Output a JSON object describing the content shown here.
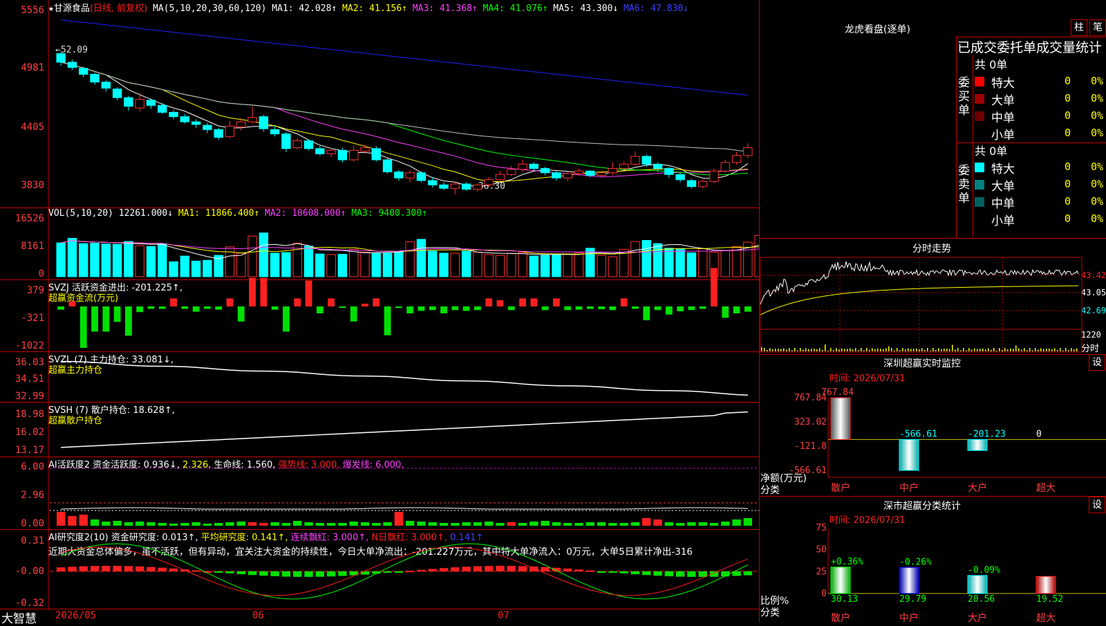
{
  "stock": {
    "star": "★",
    "name": "甘源食品",
    "mode": "(日线, 前复权)"
  },
  "kline": {
    "ma_label": "MA(5,10,20,30,60,120)",
    "ma1": "MA1: 42.028↑",
    "ma2": "MA2: 41.156↑",
    "ma3": "MA3: 41.368↑",
    "ma4": "MA4: 41.076↑",
    "ma5": "MA5: 43.300↓",
    "ma6": "MA6: 47.830↓",
    "yticks": [
      "5556",
      "4981",
      "4405",
      "3830"
    ],
    "high_label": "←52.09",
    "low_label": "←38.30",
    "candles": [
      [
        51.9,
        50.9,
        52.1,
        50.5
      ],
      [
        50.9,
        50.3,
        51.2,
        50.0
      ],
      [
        50.2,
        49.5,
        50.4,
        49.2
      ],
      [
        49.5,
        48.6,
        49.7,
        48.3
      ],
      [
        48.6,
        47.9,
        48.8,
        47.5
      ],
      [
        47.8,
        46.8,
        48.0,
        46.5
      ],
      [
        46.8,
        45.8,
        47.0,
        45.3
      ],
      [
        45.6,
        46.6,
        47.4,
        45.2
      ],
      [
        46.5,
        45.9,
        46.7,
        45.5
      ],
      [
        45.9,
        45.1,
        46.2,
        44.9
      ],
      [
        45.1,
        44.6,
        45.4,
        44.3
      ],
      [
        44.6,
        44.0,
        44.9,
        43.8
      ],
      [
        44.0,
        43.7,
        44.3,
        43.3
      ],
      [
        43.6,
        43.1,
        43.9,
        42.7
      ],
      [
        43.1,
        42.2,
        43.3,
        41.9
      ],
      [
        42.3,
        43.5,
        44.1,
        42.1
      ],
      [
        43.4,
        44.0,
        44.4,
        43.0
      ],
      [
        44.0,
        44.5,
        45.8,
        43.8
      ],
      [
        44.6,
        43.2,
        44.8,
        42.9
      ],
      [
        43.1,
        42.6,
        43.5,
        42.3
      ],
      [
        42.6,
        40.9,
        42.8,
        40.5
      ],
      [
        41.0,
        41.8,
        42.1,
        40.8
      ],
      [
        41.8,
        40.9,
        42.0,
        40.7
      ],
      [
        40.9,
        40.3,
        41.2,
        40.1
      ],
      [
        40.3,
        40.7,
        41.0,
        39.9
      ],
      [
        40.7,
        39.6,
        41.0,
        39.3
      ],
      [
        39.6,
        40.7,
        41.3,
        39.4
      ],
      [
        40.6,
        41.0,
        41.4,
        40.3
      ],
      [
        40.9,
        39.6,
        41.2,
        39.4
      ],
      [
        39.6,
        38.2,
        39.9,
        38.0
      ],
      [
        38.2,
        37.5,
        38.4,
        37.2
      ],
      [
        37.5,
        38.1,
        38.4,
        37.0
      ],
      [
        38.1,
        37.2,
        38.3,
        37.0
      ],
      [
        37.2,
        36.7,
        37.6,
        36.4
      ],
      [
        36.7,
        36.3,
        37.0,
        36.1
      ],
      [
        36.3,
        36.8,
        37.1,
        35.6
      ],
      [
        36.8,
        36.2,
        37.0,
        36.0
      ],
      [
        36.2,
        36.7,
        36.9,
        35.9
      ],
      [
        36.7,
        37.3,
        37.6,
        36.5
      ],
      [
        37.3,
        37.9,
        38.3,
        37.1
      ],
      [
        37.9,
        38.5,
        38.9,
        37.7
      ],
      [
        38.5,
        39.1,
        39.6,
        38.2
      ],
      [
        39.1,
        38.6,
        39.3,
        38.3
      ],
      [
        38.6,
        38.1,
        38.8,
        37.8
      ],
      [
        38.1,
        37.5,
        38.3,
        37.2
      ],
      [
        37.5,
        38.0,
        38.2,
        37.1
      ],
      [
        38.0,
        38.3,
        38.6,
        37.7
      ],
      [
        38.3,
        37.8,
        38.4,
        37.6
      ],
      [
        37.8,
        38.1,
        38.3,
        37.5
      ],
      [
        38.1,
        38.6,
        39.3,
        37.8
      ],
      [
        38.6,
        39.1,
        39.4,
        38.4
      ],
      [
        39.1,
        40.0,
        40.6,
        38.9
      ],
      [
        40.0,
        39.1,
        40.2,
        38.8
      ],
      [
        39.1,
        38.6,
        39.3,
        38.2
      ],
      [
        38.6,
        37.9,
        38.8,
        37.5
      ],
      [
        37.9,
        37.3,
        38.1,
        37.0
      ],
      [
        37.2,
        36.5,
        37.4,
        36.3
      ],
      [
        36.5,
        37.1,
        37.3,
        36.3
      ],
      [
        37.1,
        38.3,
        38.6,
        36.9
      ],
      [
        38.3,
        39.3,
        39.6,
        38.1
      ],
      [
        39.3,
        40.1,
        40.5,
        39.0
      ],
      [
        40.1,
        41.0,
        41.5,
        39.8
      ]
    ]
  },
  "vol": {
    "label": "VOL(5,10,20)",
    "val": "12261.000↓",
    "ma1": "MA1: 11866.400↑",
    "ma2": "MA2: 10608.000↑",
    "ma3": "MA3: 9400.300↑",
    "yticks": [
      "16526",
      "8161",
      "0"
    ],
    "values": [
      9500,
      10800,
      9300,
      9400,
      9200,
      9100,
      9900,
      8700,
      8500,
      9300,
      4200,
      5800,
      4400,
      4600,
      6000,
      8400,
      6600,
      11400,
      12300,
      6600,
      6800,
      9400,
      8600,
      6400,
      6200,
      6300,
      7700,
      6900,
      6700,
      6600,
      6900,
      9800,
      10500,
      7200,
      6600,
      6600,
      7200,
      6900,
      6200,
      6000,
      6500,
      6800,
      5800,
      6000,
      6200,
      6400,
      6700,
      8000,
      6000,
      5600,
      7700,
      9900,
      10200,
      9300,
      8000,
      7800,
      6700,
      7900,
      6900,
      7400,
      8500,
      9700,
      11600,
      12261
    ]
  },
  "svzj": {
    "label": "SVZJ  活跃资金进出: -201.225↑,",
    "sub": "超赢资金流(万元)",
    "yticks": [
      "379",
      "-321",
      "-1022"
    ],
    "values": [
      -80,
      60,
      -1022,
      -620,
      -620,
      -380,
      -720,
      -140,
      -60,
      -60,
      90,
      -60,
      -130,
      -60,
      -80,
      90,
      -370,
      320,
      320,
      -80,
      -620,
      90,
      290,
      -170,
      90,
      -20,
      -370,
      30,
      90,
      -710,
      -20,
      -170,
      -110,
      -90,
      -170,
      -90,
      -110,
      -90,
      90,
      70,
      -90,
      90,
      90,
      -90,
      90,
      -90,
      -80,
      -60,
      -70,
      -90,
      90,
      -60,
      -340,
      -90,
      -200,
      -120,
      -90,
      -60,
      430,
      -280,
      -170,
      -130
    ]
  },
  "svzl": {
    "label": "SVZL (7) 主力持仓: 33.081↓,",
    "sub": "超赢主力持仓",
    "yticks": [
      "36.03",
      "34.51",
      "32.99"
    ]
  },
  "svsh": {
    "label": "SVSH (7) 散户持仓: 18.628↑,",
    "sub": "超赢散户持仓",
    "yticks": [
      "18.98",
      "16.02",
      "13.17"
    ]
  },
  "ai1": {
    "label": "AI活跃度2 资金活跃度: 0.936↓,",
    "v2": "2.326,",
    "v3": "生命线: 1.560,",
    "v4": "强势线: 3.000,",
    "v5": "爆发线: 6.000,",
    "yticks": [
      "6.00",
      "2.96",
      "0.00"
    ]
  },
  "ai2": {
    "label": "AI研究度2(10) 资金研究度: 0.013↑,",
    "v2": "平均研究度: 0.141↑,",
    "v3": "连续飘红: 3.000↑,",
    "v4": "N日飘红: 3.000↑,",
    "v5": "0.141↑",
    "text": "近期大资金总体偏多，虽不活跃，但有异动，宜关注大资金的持续性，今日大单净流出：-201.227万元，其中特大单净流入：0万元，大单5日累计净出-316",
    "yticks": [
      "0.31",
      "-0.00",
      "-0.32"
    ]
  },
  "dates": {
    "d1": "2026/05",
    "d2": "06",
    "d3": "07"
  },
  "brand": "大智慧",
  "right": {
    "lhb_title": "龙虎看盘(逐单)",
    "btn_zhu": "柱",
    "btn_bi": "笔",
    "stats_header": "已成交委托单成交量统计",
    "buy_label": "委买单",
    "sell_label": "委卖单",
    "buy_total": "共 0单",
    "sell_total": "共 0单",
    "buy_rows": [
      {
        "name": "特大",
        "v": "0",
        "p": "0%",
        "color": "#ff0000"
      },
      {
        "name": "大单",
        "v": "0",
        "p": "0%",
        "color": "#a00000"
      },
      {
        "name": "中单",
        "v": "0",
        "p": "0%",
        "color": "#700000"
      },
      {
        "name": "小单",
        "v": "0",
        "p": "0%",
        "color": "#000000"
      }
    ],
    "sell_rows": [
      {
        "name": "特大",
        "v": "0",
        "p": "0%",
        "color": "#00ffff"
      },
      {
        "name": "大单",
        "v": "0",
        "p": "0%",
        "color": "#008080"
      },
      {
        "name": "中单",
        "v": "0",
        "p": "0%",
        "color": "#006060"
      },
      {
        "name": "小单",
        "v": "0",
        "p": "0%",
        "color": "#000000"
      }
    ],
    "fs_title": "分时走势",
    "fs_y": [
      "43.42",
      "43.05",
      "42.69"
    ],
    "fs_vol": "1220",
    "fs_vol_label": "分时",
    "sz_title": "深圳超赢实时监控",
    "sz_btn": "设",
    "sz_time": "时间: 2026/07/31",
    "sz_y": [
      "767.84",
      "323.02",
      "-121.8",
      "-566.61"
    ],
    "sz_ylabel": "净额(万元)",
    "sz_xlabel": "分类",
    "sz_bars": [
      {
        "name": "散户",
        "value": "767.84"
      },
      {
        "name": "中户",
        "value": "-566.61"
      },
      {
        "name": "大户",
        "value": "-201.23"
      },
      {
        "name": "超大",
        "value": "0"
      }
    ],
    "cls_title": "深市超赢分类统计",
    "cls_btn": "设",
    "cls_time": "时间: 2026/07/31",
    "cls_y": [
      "75",
      "50",
      "25",
      "0"
    ],
    "cls_ylabel": "比例%",
    "cls_xlabel": "分类",
    "cls_bars": [
      {
        "name": "散户",
        "value": "30.13",
        "change": "+0.36%",
        "color": "#00ff00"
      },
      {
        "name": "中户",
        "value": "29.79",
        "change": "-0.26%",
        "color": "#0000ff"
      },
      {
        "name": "大户",
        "value": "20.56",
        "change": "-0.09%",
        "color": "#00ffff"
      },
      {
        "name": "超大",
        "value": "19.52",
        "change": "",
        "color": "#ff0000"
      }
    ]
  }
}
